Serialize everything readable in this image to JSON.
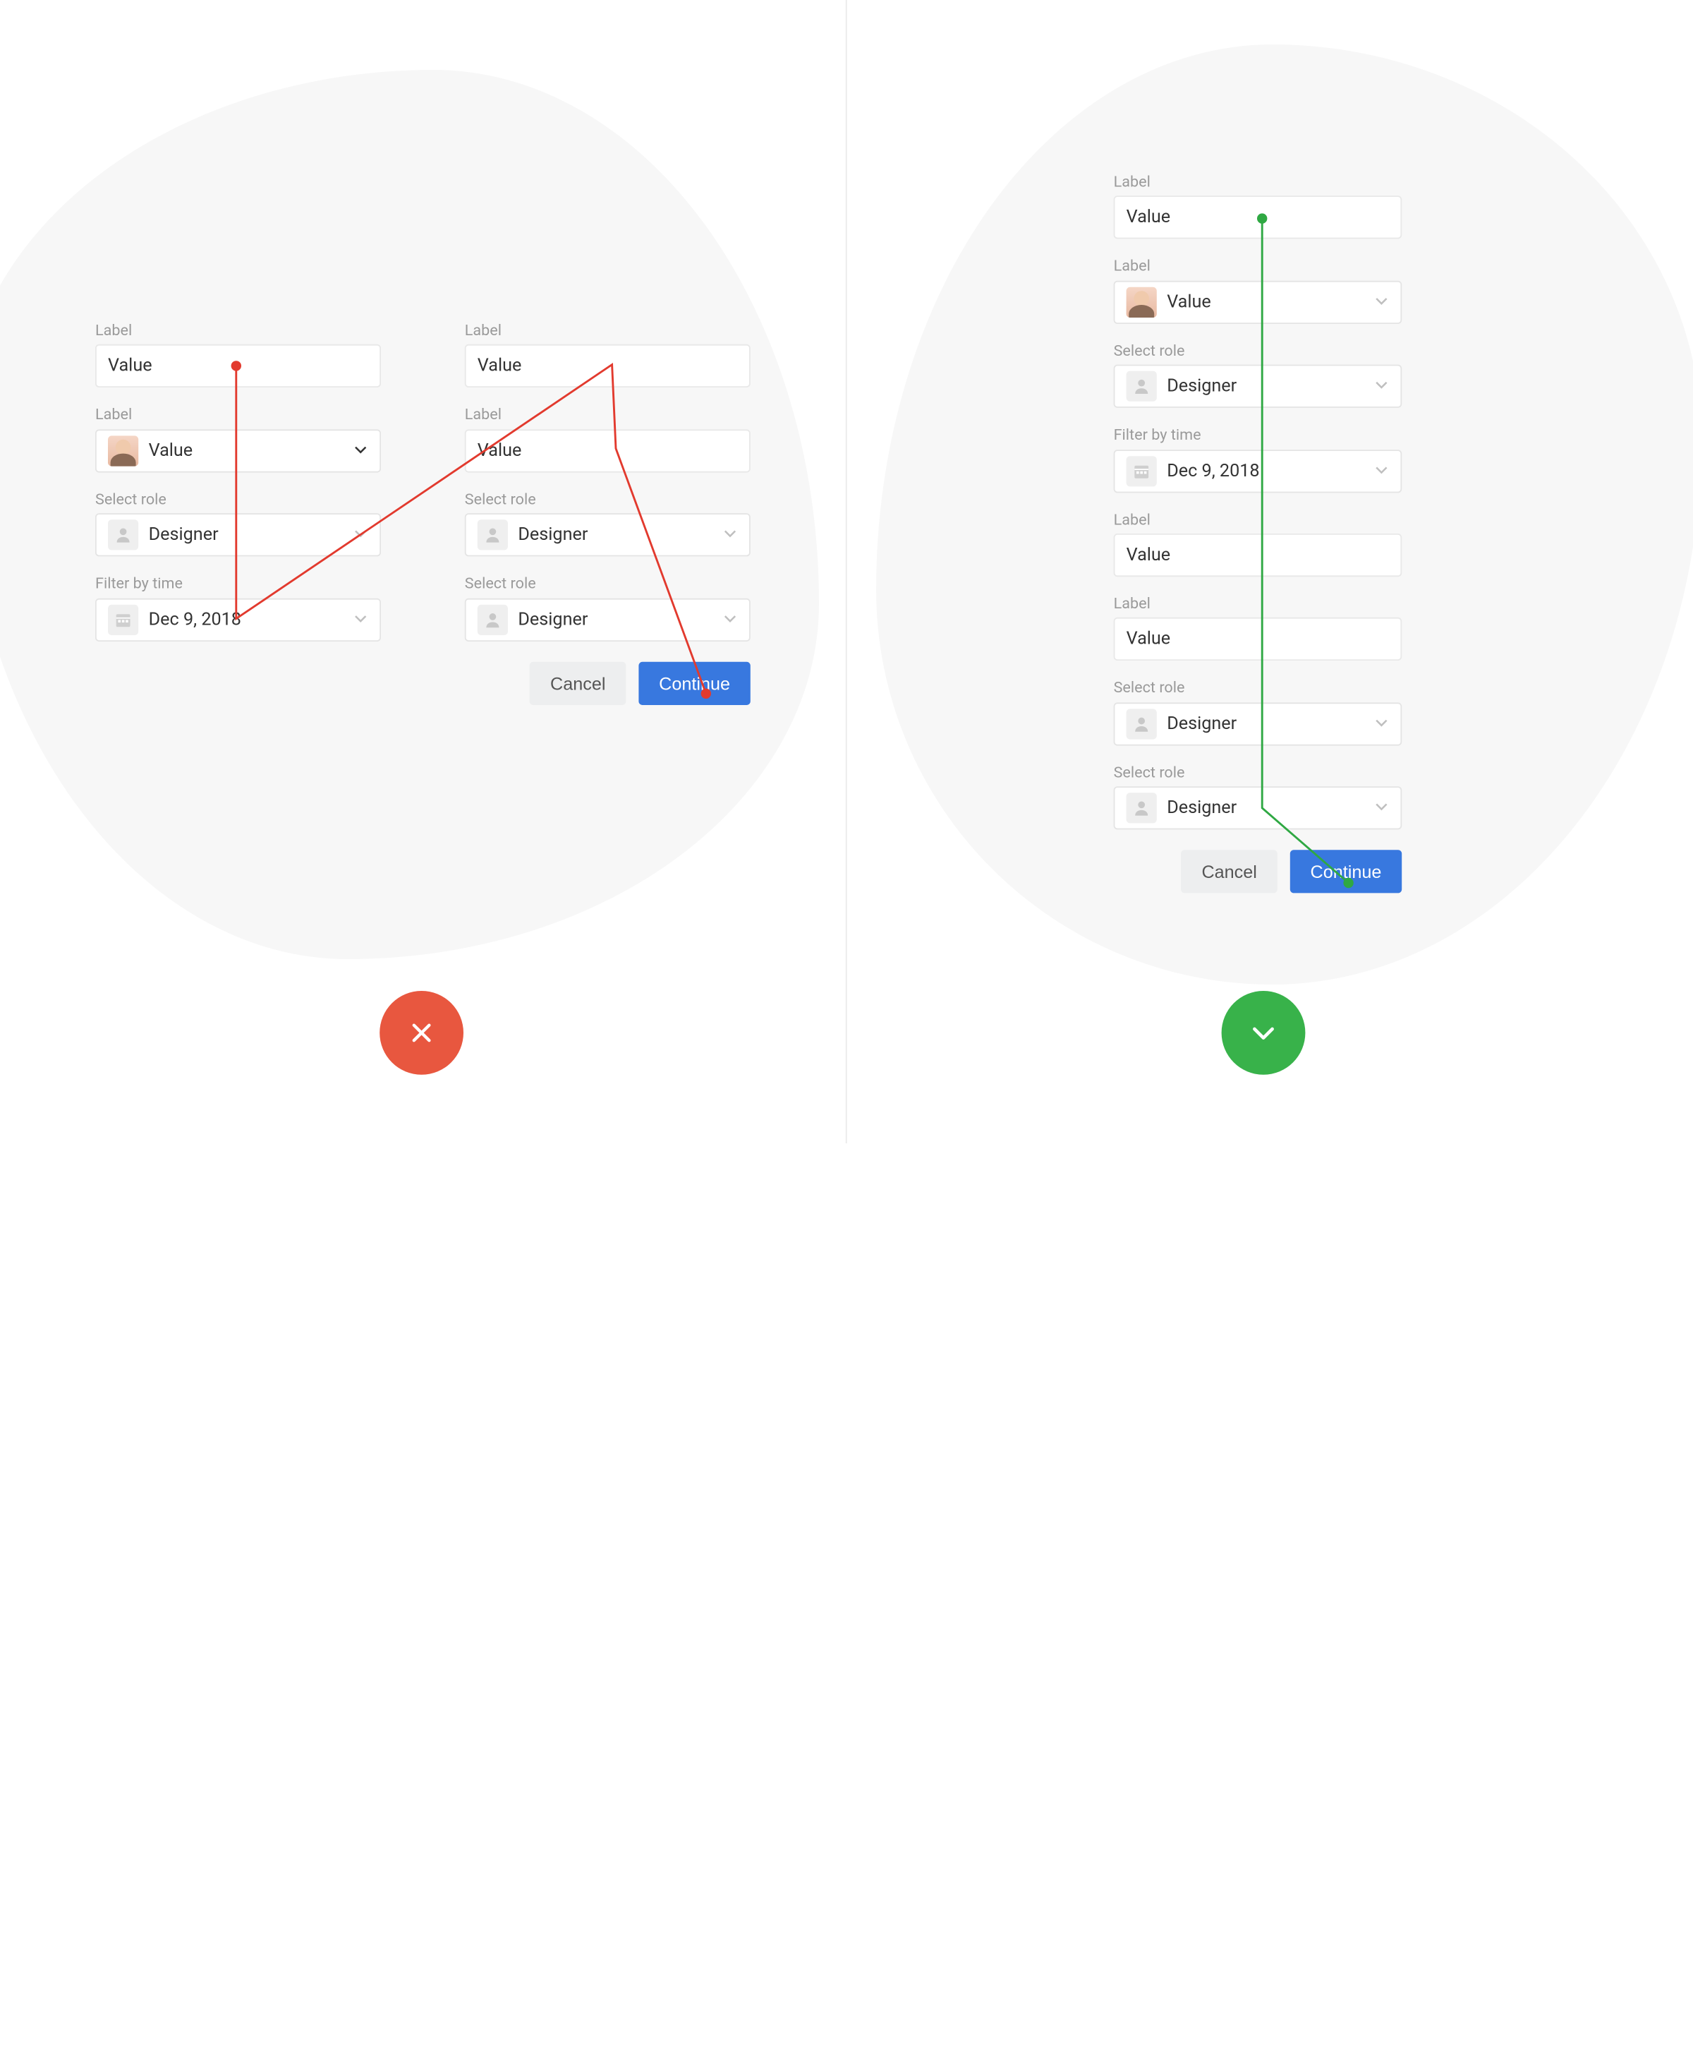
{
  "left": {
    "col1": [
      {
        "label": "Label",
        "value": "Value",
        "type": "input"
      },
      {
        "label": "Label",
        "value": "Value",
        "type": "avatar-select"
      },
      {
        "label": "Select role",
        "value": "Designer",
        "type": "person-select"
      },
      {
        "label": "Filter by time",
        "value": "Dec 9, 2018",
        "type": "date-select"
      }
    ],
    "col2": [
      {
        "label": "Label",
        "value": "Value",
        "type": "input"
      },
      {
        "label": "Label",
        "value": "Value",
        "type": "input"
      },
      {
        "label": "Select role",
        "value": "Designer",
        "type": "person-select"
      },
      {
        "label": "Select role",
        "value": "Designer",
        "type": "person-select"
      }
    ],
    "buttons": {
      "cancel": "Cancel",
      "continue": "Continue"
    }
  },
  "right": {
    "fields": [
      {
        "label": "Label",
        "value": "Value",
        "type": "input"
      },
      {
        "label": "Label",
        "value": "Value",
        "type": "avatar-select"
      },
      {
        "label": "Select role",
        "value": "Designer",
        "type": "person-select"
      },
      {
        "label": "Filter by time",
        "value": "Dec 9, 2018",
        "type": "date-select"
      },
      {
        "label": "Label",
        "value": "Value",
        "type": "input"
      },
      {
        "label": "Label",
        "value": "Value",
        "type": "input"
      },
      {
        "label": "Select role",
        "value": "Designer",
        "type": "person-select"
      },
      {
        "label": "Select role",
        "value": "Designer",
        "type": "person-select"
      }
    ],
    "buttons": {
      "cancel": "Cancel",
      "continue": "Continue"
    }
  },
  "colors": {
    "error": "#e8573f",
    "success": "#38b24a",
    "primary": "#3878df"
  }
}
